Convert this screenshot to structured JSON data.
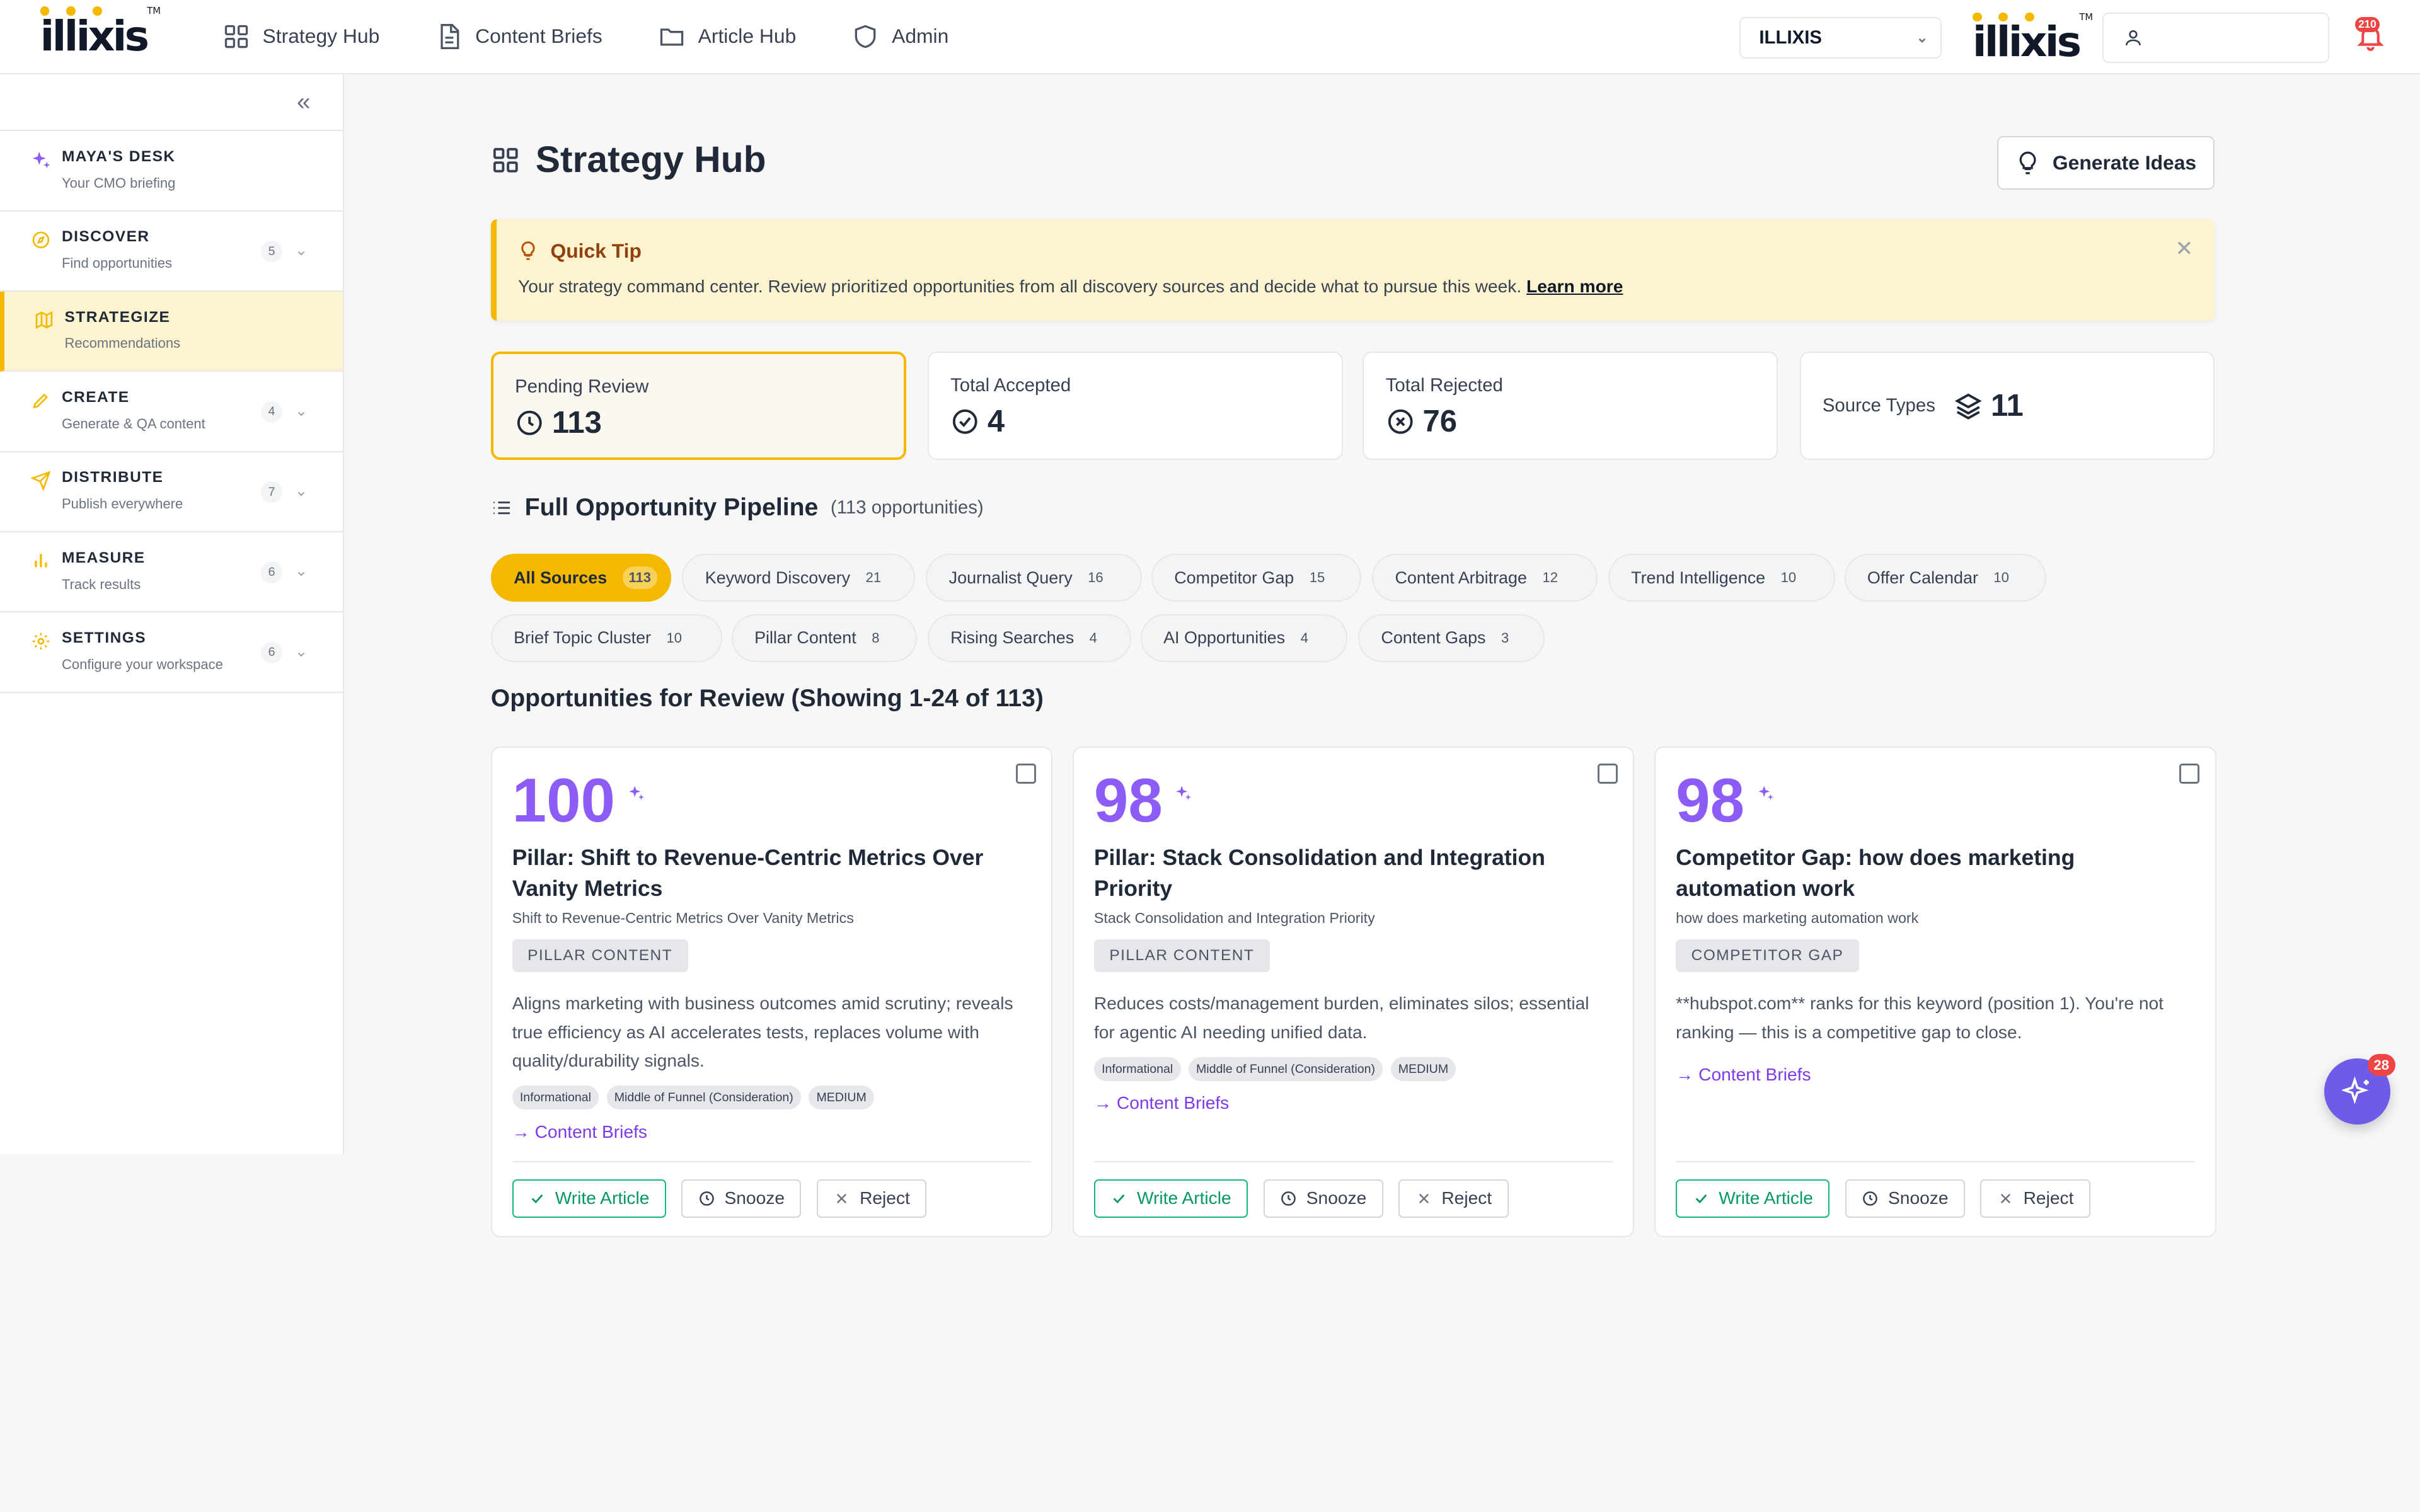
{
  "brand": {
    "logo_text": "illixis",
    "tm": "TM",
    "accent": "#f5b800",
    "purple": "#8b5cf6"
  },
  "nav": [
    {
      "label": "Strategy Hub",
      "icon": "grid-icon"
    },
    {
      "label": "Content Briefs",
      "icon": "document-icon"
    },
    {
      "label": "Article Hub",
      "icon": "folder-icon"
    },
    {
      "label": "Admin",
      "icon": "shield-icon"
    }
  ],
  "workspace": {
    "selected": "ILLIXIS"
  },
  "notifications": {
    "count": "210"
  },
  "sidebar": {
    "items": [
      {
        "title": "MAYA'S DESK",
        "sub": "Your CMO briefing",
        "count": "",
        "icon": "sparkle-icon"
      },
      {
        "title": "DISCOVER",
        "sub": "Find opportunities",
        "count": "5",
        "icon": "compass-icon"
      },
      {
        "title": "STRATEGIZE",
        "sub": "Recommendations",
        "count": "",
        "icon": "map-icon",
        "active": true
      },
      {
        "title": "CREATE",
        "sub": "Generate & QA content",
        "count": "4",
        "icon": "pen-icon"
      },
      {
        "title": "DISTRIBUTE",
        "sub": "Publish everywhere",
        "count": "7",
        "icon": "send-icon"
      },
      {
        "title": "MEASURE",
        "sub": "Track results",
        "count": "6",
        "icon": "bar-chart-icon"
      },
      {
        "title": "SETTINGS",
        "sub": "Configure your workspace",
        "count": "6",
        "icon": "gear-icon"
      }
    ]
  },
  "page": {
    "title": "Strategy Hub",
    "generate_label": "Generate Ideas"
  },
  "tip": {
    "title": "Quick Tip",
    "body": "Your strategy command center. Review prioritized opportunities from all discovery sources and decide what to pursue this week.",
    "link": "Learn more"
  },
  "stats": [
    {
      "label": "Pending Review",
      "value": "113",
      "icon": "clock-icon"
    },
    {
      "label": "Total Accepted",
      "value": "4",
      "icon": "check-circle-icon"
    },
    {
      "label": "Total Rejected",
      "value": "76",
      "icon": "x-circle-icon"
    },
    {
      "label": "Source Types",
      "value": "11",
      "icon": "layers-icon"
    }
  ],
  "pipeline": {
    "title": "Full Opportunity Pipeline",
    "sub": "(113 opportunities)"
  },
  "filters": [
    {
      "label": "All Sources",
      "count": "113",
      "active": true
    },
    {
      "label": "Keyword Discovery",
      "count": "21"
    },
    {
      "label": "Journalist Query",
      "count": "16"
    },
    {
      "label": "Competitor Gap",
      "count": "15"
    },
    {
      "label": "Content Arbitrage",
      "count": "12"
    },
    {
      "label": "Trend Intelligence",
      "count": "10"
    },
    {
      "label": "Offer Calendar",
      "count": "10"
    },
    {
      "label": "Brief Topic Cluster",
      "count": "10"
    },
    {
      "label": "Pillar Content",
      "count": "8"
    },
    {
      "label": "Rising Searches",
      "count": "4"
    },
    {
      "label": "AI Opportunities",
      "count": "4"
    },
    {
      "label": "Content Gaps",
      "count": "3"
    }
  ],
  "opportunities": {
    "heading": "Opportunities for Review (Showing 1-24 of 113)",
    "cards": [
      {
        "score": "100",
        "title": "Pillar: Shift to Revenue-Centric Metrics Over Vanity Metrics",
        "sub": "Shift to Revenue-Centric Metrics Over Vanity Metrics",
        "tag": "PILLAR CONTENT",
        "desc": "Aligns marketing with business outcomes amid scrutiny; reveals true efficiency as AI accelerates tests, replaces volume with quality/durability signals.",
        "pills": [
          "Informational",
          "Middle of Funnel (Consideration)",
          "MEDIUM"
        ],
        "link": "→ Content Briefs"
      },
      {
        "score": "98",
        "title": "Pillar: Stack Consolidation and Integration Priority",
        "sub": "Stack Consolidation and Integration Priority",
        "tag": "PILLAR CONTENT",
        "desc": "Reduces costs/management burden, eliminates silos; essential for agentic AI needing unified data.",
        "pills": [
          "Informational",
          "Middle of Funnel (Consideration)",
          "MEDIUM"
        ],
        "link": "→ Content Briefs"
      },
      {
        "score": "98",
        "title": "Competitor Gap: how does marketing automation work",
        "sub": "how does marketing automation work",
        "tag": "COMPETITOR GAP",
        "desc": "**hubspot.com** ranks for this keyword (position 1). You're not ranking — this is a competitive gap to close.",
        "pills": [],
        "link": "→ Content Briefs"
      }
    ],
    "actions": {
      "write": "Write Article",
      "snooze": "Snooze",
      "reject": "Reject"
    }
  },
  "assistant": {
    "badge": "28"
  }
}
